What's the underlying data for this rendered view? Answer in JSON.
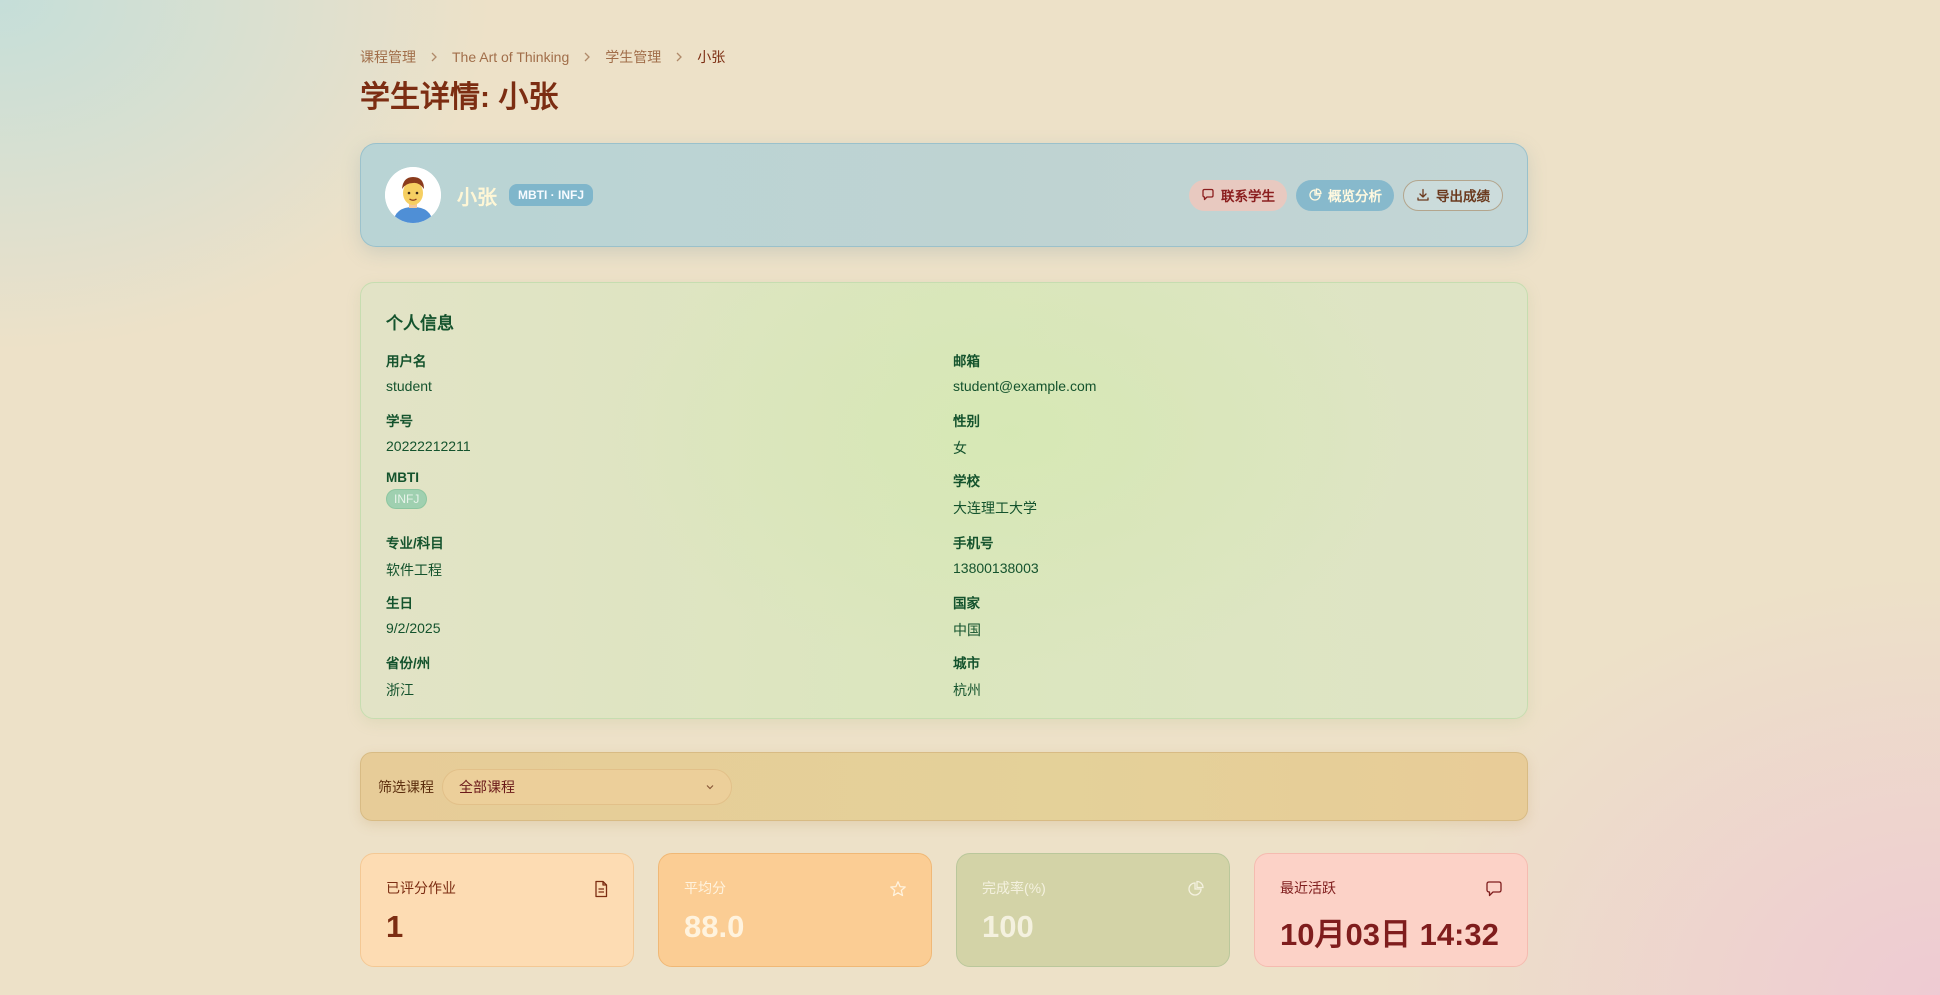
{
  "breadcrumb": {
    "items": [
      "课程管理",
      "The Art of Thinking",
      "学生管理"
    ],
    "current": "小张"
  },
  "page": {
    "title": "学生详情: 小张"
  },
  "student": {
    "name": "小张",
    "mbti_badge": "MBTI · INFJ",
    "avatar_icon": "student-avatar-icon"
  },
  "actions": {
    "contact_label": "联系学生",
    "overview_label": "概览分析",
    "export_label": "导出成绩"
  },
  "info": {
    "title": "个人信息",
    "username": {
      "label": "用户名",
      "value": "student"
    },
    "email": {
      "label": "邮箱",
      "value": "student@example.com"
    },
    "student_id": {
      "label": "学号",
      "value": "20222212211"
    },
    "gender": {
      "label": "性别",
      "value": "女"
    },
    "mbti": {
      "label": "MBTI",
      "value": "INFJ"
    },
    "school": {
      "label": "学校",
      "value": "大连理工大学"
    },
    "major": {
      "label": "专业/科目",
      "value": "软件工程"
    },
    "phone": {
      "label": "手机号",
      "value": "13800138003"
    },
    "birthday": {
      "label": "生日",
      "value": "9/2/2025"
    },
    "country": {
      "label": "国家",
      "value": "中国"
    },
    "province": {
      "label": "省份/州",
      "value": "浙江"
    },
    "city": {
      "label": "城市",
      "value": "杭州"
    }
  },
  "filter": {
    "label": "筛选课程",
    "selected": "全部课程"
  },
  "stats": [
    {
      "label": "已评分作业",
      "value": "1",
      "icon": "document-icon"
    },
    {
      "label": "平均分",
      "value": "88.0",
      "icon": "star-icon"
    },
    {
      "label": "完成率(%)",
      "value": "100",
      "icon": "pie-chart-icon"
    },
    {
      "label": "最近活跃",
      "value": "10月03日 14:32",
      "icon": "message-icon"
    }
  ],
  "colors": {
    "primary_text": "#7c2d12",
    "info_text": "#14532d",
    "header_bg": "#bfd3d2",
    "info_bg": "#dbe6be",
    "filter_bg": "#e4d199"
  }
}
